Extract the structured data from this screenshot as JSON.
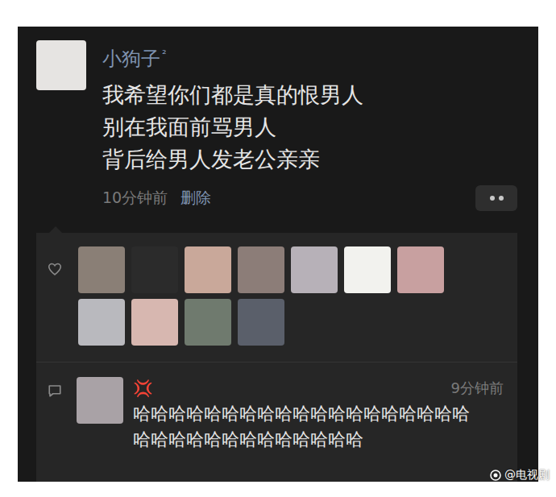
{
  "post": {
    "author": "小狗子",
    "author_badge": "²",
    "avatar_color": "#e6e4e2",
    "lines": [
      "我希望你们都是真的恨男人",
      "别在我面前骂男人",
      "背后给男人发老公亲亲"
    ],
    "time": "10分钟前",
    "delete": "删除"
  },
  "likes": [
    {
      "color": "#8a7f76"
    },
    {
      "color": "#2b2b2b"
    },
    {
      "color": "#c9a89a"
    },
    {
      "color": "#8c7d78"
    },
    {
      "color": "#b7b1b8"
    },
    {
      "color": "#f2f2ee"
    },
    {
      "color": "#c8a0a0"
    },
    {
      "color": "#b9b9be"
    },
    {
      "color": "#d7b7b0"
    },
    {
      "color": "#6f7a6e"
    },
    {
      "color": "#5a5f6a"
    }
  ],
  "comments": [
    {
      "author": "💢",
      "avatar_color": "#a9a2a6",
      "time": "9分钟前",
      "text": "哈哈哈哈哈哈哈哈哈哈哈哈哈哈哈哈哈哈哈哈哈哈哈哈哈哈哈哈哈哈哈哈"
    }
  ],
  "watermark": "@电视剧"
}
